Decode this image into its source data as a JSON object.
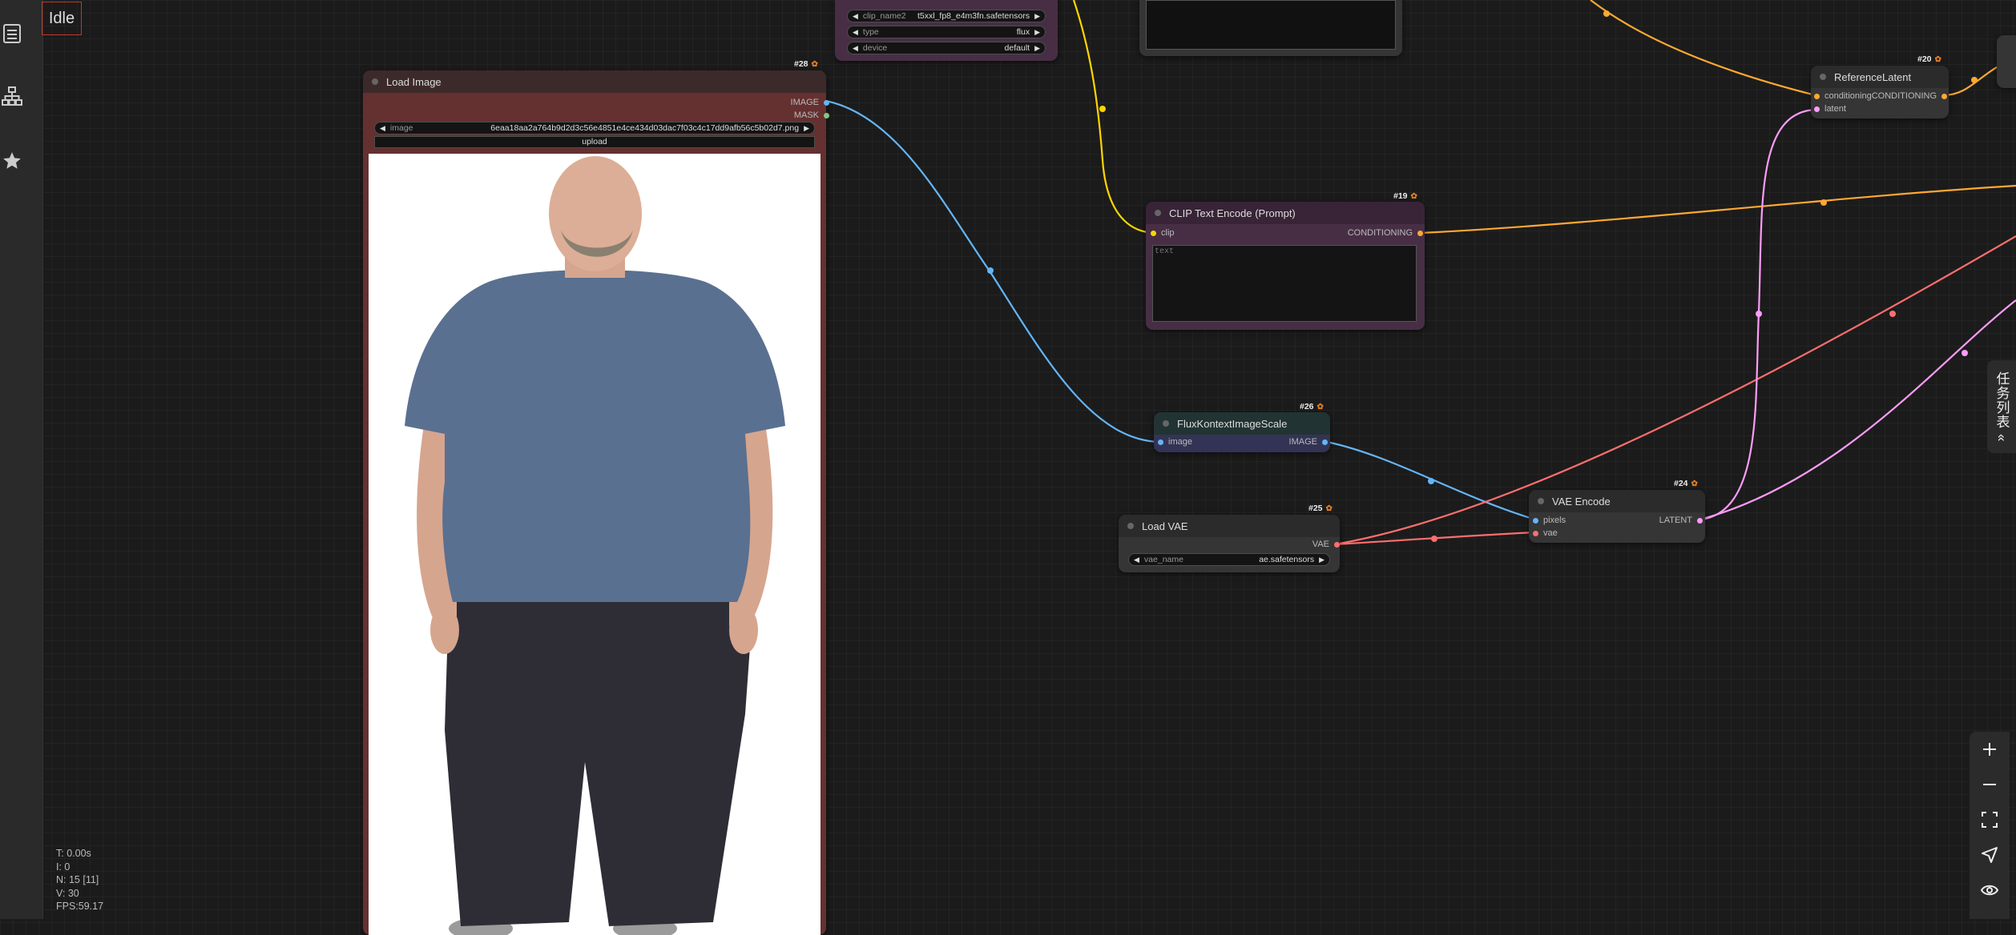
{
  "status": {
    "label": "Idle"
  },
  "stats": {
    "time": "T: 0.00s",
    "iterations": "I: 0",
    "nodes": "N: 15 [11]",
    "vertices": "V: 30",
    "fps": "FPS:59.17"
  },
  "sidebar": {
    "items": [
      {
        "icon": "queue-icon"
      },
      {
        "icon": "workflow-icon"
      },
      {
        "icon": "star-icon"
      }
    ]
  },
  "colors": {
    "image_link": "#64b5f6",
    "clip_link": "#ffd500",
    "conditioning_link": "#ffa931",
    "latent_link": "#ff9cf9",
    "vae_link": "#ff6e6e"
  },
  "nodes": {
    "dual_clip": {
      "widgets": [
        {
          "label": "clip_name2",
          "value": "t5xxl_fp8_e4m3fn.safetensors"
        },
        {
          "label": "type",
          "value": "flux"
        },
        {
          "label": "device",
          "value": "default"
        }
      ]
    },
    "load_image": {
      "id": "#28",
      "title": "Load Image",
      "outputs": [
        "IMAGE",
        "MASK"
      ],
      "widget": {
        "label": "image",
        "value": "6eaa18aa2a764b9d2d3c56e4851e4ce434d03dac7f03c4c17dd9afb56c5b02d7.png"
      },
      "upload_label": "upload"
    },
    "clip_text_encode": {
      "id": "#19",
      "title": "CLIP Text Encode (Prompt)",
      "input": "clip",
      "output": "CONDITIONING",
      "text_placeholder": "text"
    },
    "flux_kontext_scale": {
      "id": "#26",
      "title": "FluxKontextImageScale",
      "input": "image",
      "output": "IMAGE"
    },
    "load_vae": {
      "id": "#25",
      "title": "Load VAE",
      "output": "VAE",
      "widget": {
        "label": "vae_name",
        "value": "ae.safetensors"
      }
    },
    "vae_encode": {
      "id": "#24",
      "title": "VAE Encode",
      "inputs": [
        "pixels",
        "vae"
      ],
      "output": "LATENT"
    },
    "reference_latent": {
      "id": "#20",
      "title": "ReferenceLatent",
      "inputs": [
        "conditioning",
        "latent"
      ],
      "output": "CONDITIONING"
    }
  },
  "task_panel": {
    "label": "任务列表",
    "icon": "collapse-left-icon"
  },
  "canvas_tools": [
    {
      "icon": "zoom-in-icon"
    },
    {
      "icon": "zoom-out-icon"
    },
    {
      "icon": "fit-view-icon"
    },
    {
      "icon": "navigate-icon"
    },
    {
      "icon": "eye-icon"
    }
  ]
}
